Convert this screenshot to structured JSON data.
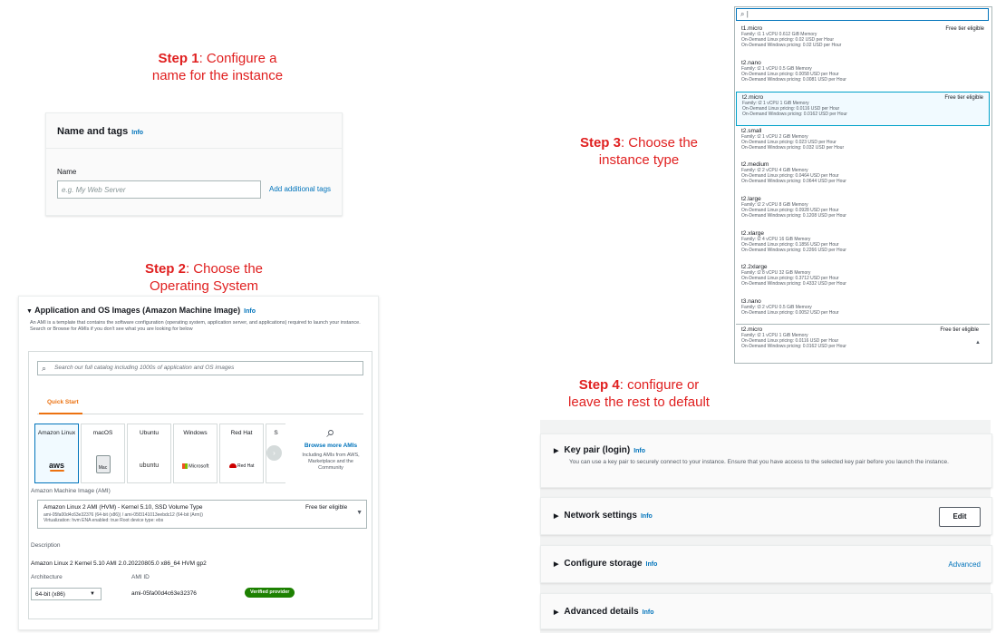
{
  "steps": {
    "step1": {
      "label": "Step 1",
      "text_line1": ": Configure a",
      "text_line2": "name for the instance"
    },
    "step2": {
      "label": "Step 2",
      "text_line1": ": Choose the",
      "text_line2": "Operating System"
    },
    "step3": {
      "label": "Step 3",
      "text_line1": ": Choose the",
      "text_line2": "instance type"
    },
    "step4": {
      "label": "Step 4",
      "text_line1": ": configure or",
      "text_line2": "leave the rest to default"
    }
  },
  "name_tags": {
    "title": "Name and tags",
    "info": "Info",
    "name_label": "Name",
    "name_placeholder": "e.g. My Web Server",
    "add_tags": "Add additional tags"
  },
  "ami": {
    "title": "Application and OS Images (Amazon Machine Image)",
    "info": "Info",
    "description": "An AMI is a template that contains the software configuration (operating system, application server, and applications) required to launch your instance. Search or Browse for AMIs if you don't see what you are looking for below",
    "search_placeholder": "Search our full catalog including 1000s of application and OS images",
    "quick_start": "Quick Start",
    "tiles": [
      {
        "name": "Amazon Linux",
        "logo": "aws"
      },
      {
        "name": "macOS",
        "logo": "Mac"
      },
      {
        "name": "Ubuntu",
        "logo": "ubuntu"
      },
      {
        "name": "Windows",
        "logo": "Microsoft"
      },
      {
        "name": "Red Hat",
        "logo": "Red Hat"
      },
      {
        "name": "S",
        "logo": ""
      }
    ],
    "browse_label": "Browse more AMIs",
    "browse_sub": "Including AMIs from AWS, Marketplace and the Community",
    "ami_label": "Amazon Machine Image (AMI)",
    "selected_ami": "Amazon Linux 2 AMI (HVM) - Kernel 5.10, SSD Volume Type",
    "selected_ami_ids": "ami-05fa00d4c63e32376 (64-bit (x86)) / ami-05f3141013eebdc12 (64-bit (Arm))",
    "selected_ami_meta": "Virtualization: hvm    ENA enabled: true    Root device type: ebs",
    "free_tier": "Free tier eligible",
    "description_label": "Description",
    "description_value": "Amazon Linux 2 Kernel 5.10 AMI 2.0.20220805.0 x86_64 HVM gp2",
    "architecture_label": "Architecture",
    "architecture_value": "64-bit (x86)",
    "ami_id_label": "AMI ID",
    "ami_id_value": "ami-05fa00d4c63e32376",
    "verified": "Verified provider"
  },
  "instances": {
    "search_value": "|",
    "items": [
      {
        "name": "t1.micro",
        "family": "Family: t1    1 vCPU    0.612 GiB Memory",
        "linux": "On-Demand Linux pricing: 0.02 USD per Hour",
        "windows": "On-Demand Windows pricing: 0.02 USD per Hour",
        "badge": "Free tier eligible"
      },
      {
        "name": "t2.nano",
        "family": "Family: t2    1 vCPU    0.5 GiB Memory",
        "linux": "On-Demand Linux pricing: 0.0058 USD per Hour",
        "windows": "On-Demand Windows pricing: 0.0081 USD per Hour",
        "badge": ""
      },
      {
        "name": "t2.micro",
        "family": "Family: t2    1 vCPU    1 GiB Memory",
        "linux": "On-Demand Linux pricing: 0.0116 USD per Hour",
        "windows": "On-Demand Windows pricing: 0.0162 USD per Hour",
        "badge": "Free tier eligible"
      },
      {
        "name": "t2.small",
        "family": "Family: t2    1 vCPU    2 GiB Memory",
        "linux": "On-Demand Linux pricing: 0.023 USD per Hour",
        "windows": "On-Demand Windows pricing: 0.032 USD per Hour",
        "badge": ""
      },
      {
        "name": "t2.medium",
        "family": "Family: t2    2 vCPU    4 GiB Memory",
        "linux": "On-Demand Linux pricing: 0.0464 USD per Hour",
        "windows": "On-Demand Windows pricing: 0.0644 USD per Hour",
        "badge": ""
      },
      {
        "name": "t2.large",
        "family": "Family: t2    2 vCPU    8 GiB Memory",
        "linux": "On-Demand Linux pricing: 0.0928 USD per Hour",
        "windows": "On-Demand Windows pricing: 0.1208 USD per Hour",
        "badge": ""
      },
      {
        "name": "t2.xlarge",
        "family": "Family: t2    4 vCPU    16 GiB Memory",
        "linux": "On-Demand Linux pricing: 0.1856 USD per Hour",
        "windows": "On-Demand Windows pricing: 0.2266 USD per Hour",
        "badge": ""
      },
      {
        "name": "t2.2xlarge",
        "family": "Family: t2    8 vCPU    32 GiB Memory",
        "linux": "On-Demand Linux pricing: 0.3712 USD per Hour",
        "windows": "On-Demand Windows pricing: 0.4332 USD per Hour",
        "badge": ""
      },
      {
        "name": "t3.nano",
        "family": "Family: t3    2 vCPU    0.5 GiB Memory",
        "linux": "On-Demand Linux pricing: 0.0052 USD per Hour",
        "windows": "",
        "badge": ""
      }
    ],
    "selected": {
      "name": "t2.micro",
      "family": "Family: t2    1 vCPU    1 GiB Memory",
      "linux": "On-Demand Linux pricing: 0.0116 USD per Hour",
      "windows": "On-Demand Windows pricing: 0.0162 USD per Hour",
      "badge": "Free tier eligible"
    }
  },
  "sections": {
    "key_pair": {
      "title": "Key pair (login)",
      "info": "Info",
      "desc": "You can use a key pair to securely connect to your instance. Ensure that you have access to the selected key pair before you launch the instance."
    },
    "network": {
      "title": "Network settings",
      "info": "Info",
      "button": "Edit"
    },
    "storage": {
      "title": "Configure storage",
      "info": "Info",
      "link": "Advanced"
    },
    "advanced": {
      "title": "Advanced details",
      "info": "Info"
    }
  }
}
